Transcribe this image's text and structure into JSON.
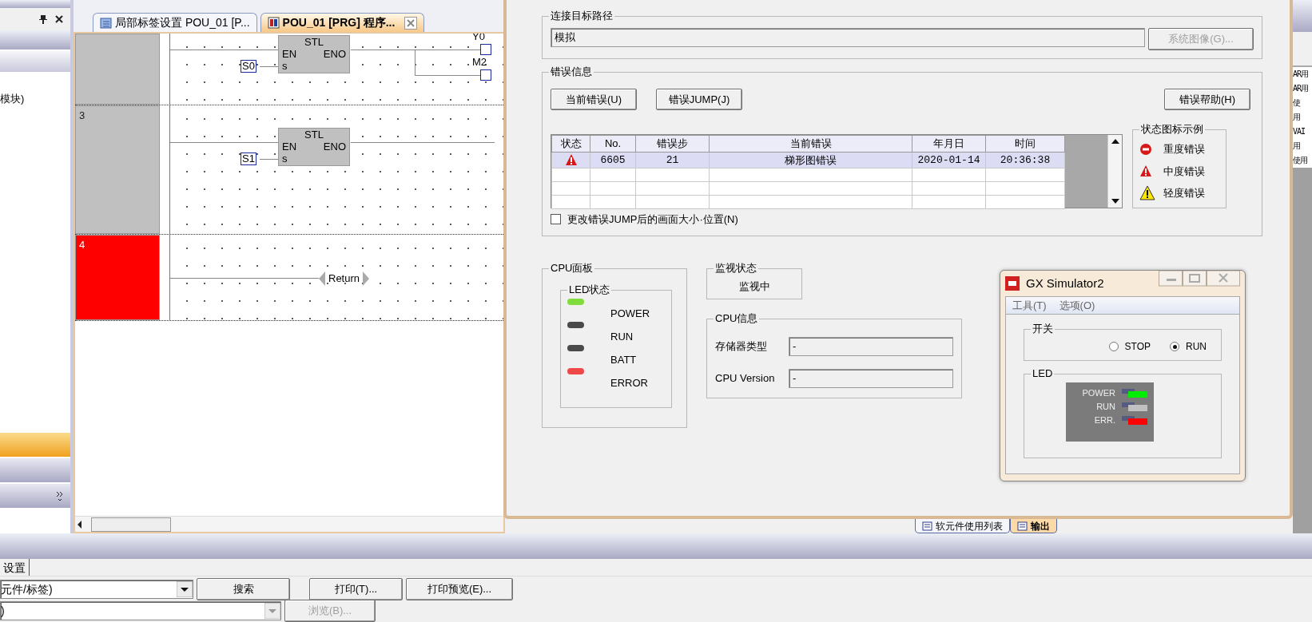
{
  "left_panel": {
    "tree_item": "模块)",
    "nav_bars": [
      {
        "selected": true
      },
      {
        "selected": false
      },
      {
        "selected": false
      }
    ]
  },
  "editor_tabs": [
    {
      "label": "局部标签设置 POU_01 [P...",
      "selected": false
    },
    {
      "label": "POU_01 [PRG] 程序...",
      "selected": true
    }
  ],
  "ladder": {
    "rungs": [
      {
        "error": false,
        "kind": "stl",
        "block": "STL",
        "en": "EN",
        "eno": "ENO",
        "s": "s",
        "operand": "S0",
        "coils": [
          "Y0",
          "M2"
        ]
      },
      {
        "number": "3",
        "error": false,
        "kind": "stl",
        "block": "STL",
        "en": "EN",
        "eno": "ENO",
        "s": "s",
        "operand": "S1"
      },
      {
        "number": "4",
        "error": true,
        "kind": "return",
        "label": "Return"
      }
    ]
  },
  "dialog": {
    "connection": {
      "title": "连接目标路径",
      "value": "模拟",
      "button": {
        "label": "系统图像(G)...",
        "disabled": true
      }
    },
    "error_info": {
      "title": "错误信息",
      "buttons": [
        "当前错误(U)",
        "错误JUMP(J)",
        "错误帮助(H)"
      ],
      "table": {
        "columns": [
          "状态",
          "No.",
          "错误步",
          "当前错误",
          "年月日",
          "时间"
        ],
        "rows": [
          {
            "kind": "medium",
            "no": "6605",
            "step": "21",
            "error": "梯形图错误",
            "date": "2020-01-14",
            "time": "20:36:38",
            "selected": true
          }
        ]
      },
      "legend": {
        "title": "状态图标示例",
        "items": [
          {
            "kind": "major",
            "label": "重度错误"
          },
          {
            "kind": "medium",
            "label": "中度错误"
          },
          {
            "kind": "minor",
            "label": "轻度错误"
          }
        ]
      },
      "checkbox": {
        "label": "更改错误JUMP后的画面大小·位置(N)",
        "checked": false
      }
    },
    "cpu_panel": {
      "title": "CPU面板",
      "led_title": "LED状态",
      "leds": [
        {
          "label": "POWER",
          "color": "#7fdc3c"
        },
        {
          "label": "RUN",
          "color": "#4a4a4a"
        },
        {
          "label": "BATT",
          "color": "#4a4a4a"
        },
        {
          "label": "ERROR",
          "color": "#f04848"
        }
      ]
    },
    "monitor": {
      "title": "监视状态",
      "value": "监视中"
    },
    "cpu_info": {
      "title": "CPU信息",
      "fields": [
        {
          "label": "存储器类型",
          "value": "-"
        },
        {
          "label": "CPU Version",
          "value": "-"
        }
      ]
    }
  },
  "simulator": {
    "title": "GX Simulator2",
    "menu": [
      "工具(T)",
      "选项(O)"
    ],
    "switch": {
      "title": "开关",
      "options": [
        {
          "label": "STOP",
          "selected": false
        },
        {
          "label": "RUN",
          "selected": true
        }
      ]
    },
    "led": {
      "title": "LED",
      "items": [
        {
          "label": "POWER",
          "color": "#00ee00"
        },
        {
          "label": "RUN",
          "color": "#c0c0c0"
        },
        {
          "label": "ERR.",
          "color": "#ff0000"
        }
      ]
    }
  },
  "output_tabs": [
    {
      "label": "软元件使用列表",
      "selected": false
    },
    {
      "label": "输出",
      "selected": true
    }
  ],
  "right_list": [
    "AR用",
    "AR用",
    "使",
    "用",
    "VAI",
    "用",
    "使用"
  ],
  "bottom": {
    "tab": "设置",
    "search_combo": "元件/标签)",
    "search_button": "搜索",
    "print_button": {
      "label": "打印(T)...",
      "disabled": false
    },
    "preview_button": {
      "label": "打印预览(E)...",
      "disabled": false
    },
    "combo2": ")",
    "browse_button": {
      "label": "浏览(B)...",
      "disabled": true
    }
  }
}
